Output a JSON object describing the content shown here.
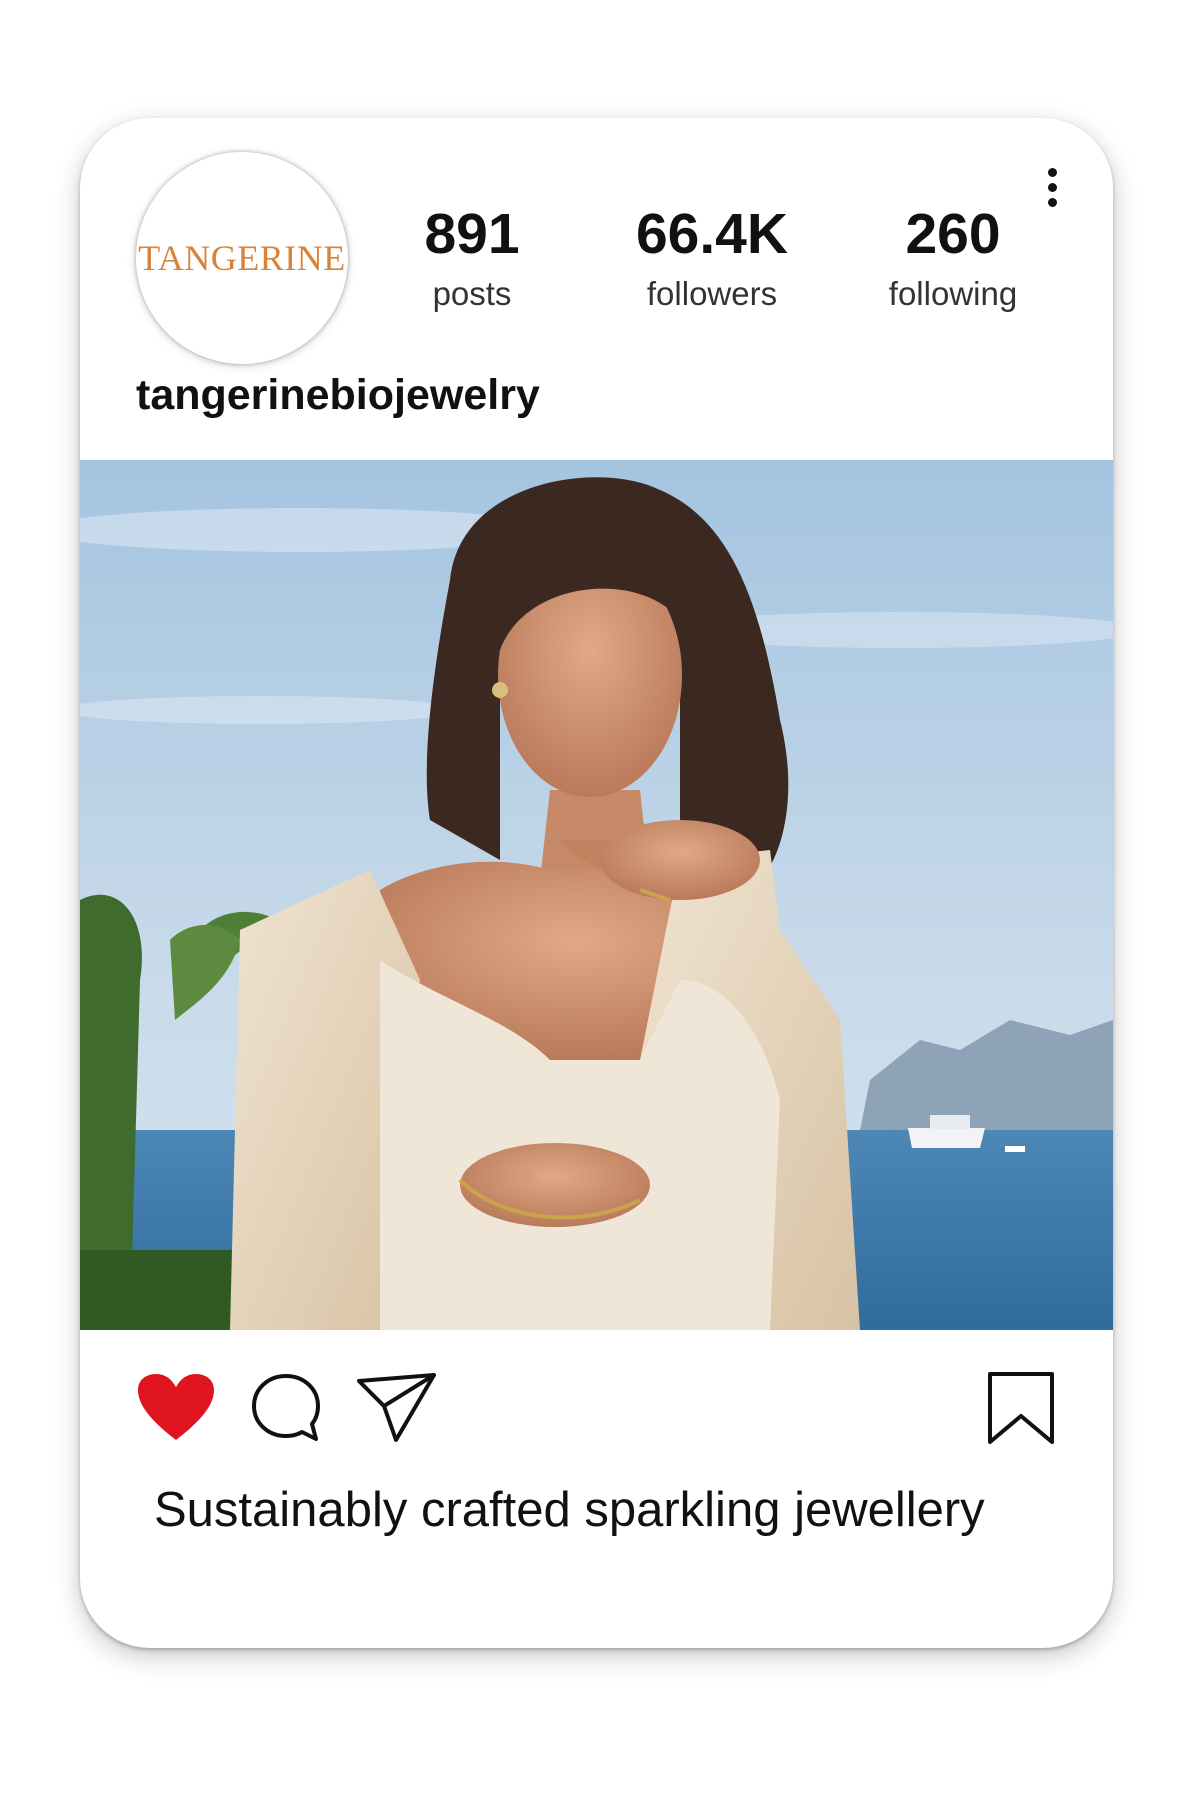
{
  "profile": {
    "logo_text": "TANGERINE",
    "username": "tangerinebiojewelry",
    "stats": [
      {
        "value": "891",
        "label": "posts"
      },
      {
        "value": "66.4K",
        "label": "followers"
      },
      {
        "value": "260",
        "label": "following"
      }
    ]
  },
  "post": {
    "caption": "Sustainably crafted sparkling jewellery",
    "liked": true
  },
  "icons": {
    "more": "more-vertical-icon",
    "like": "heart-icon",
    "comment": "comment-icon",
    "share": "send-icon",
    "save": "bookmark-icon"
  },
  "colors": {
    "brand": "#d8833a",
    "like": "#e0141e"
  }
}
